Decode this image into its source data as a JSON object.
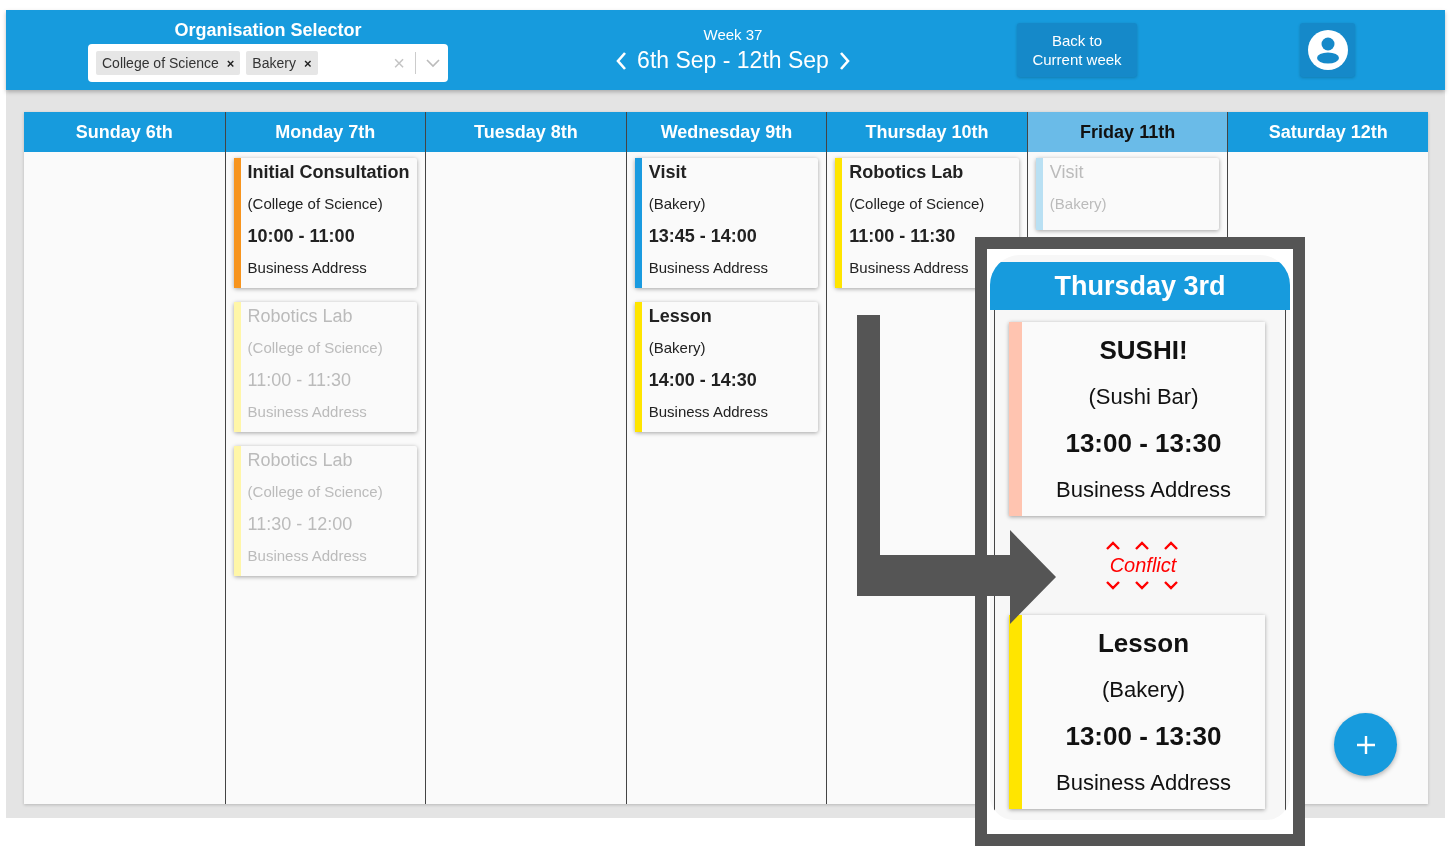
{
  "header": {
    "selector_label": "Organisation Selector",
    "selected_orgs": [
      {
        "label": "College of Science"
      },
      {
        "label": "Bakery"
      }
    ],
    "tag_remove": "×",
    "clear": "×",
    "week_label": "Week 37",
    "range": "6th Sep - 12th Sep",
    "back_button": "Back to Current week"
  },
  "days": [
    {
      "label": "Sunday 6th",
      "selected": false
    },
    {
      "label": "Monday 7th",
      "selected": false,
      "events": [
        {
          "title": "Initial Consultation",
          "org": "(College of Science)",
          "time": "10:00 - 11:00",
          "address": "Business Address",
          "color": "#f7941d",
          "faded": false
        },
        {
          "title": "Robotics Lab",
          "org": "(College of Science)",
          "time": "11:00 - 11:30",
          "address": "Business Address",
          "color": "#fff6a8",
          "faded": true
        },
        {
          "title": "Robotics Lab",
          "org": "(College of Science)",
          "time": "11:30 - 12:00",
          "address": "Business Address",
          "color": "#fff6a8",
          "faded": true
        }
      ]
    },
    {
      "label": "Tuesday 8th",
      "selected": false
    },
    {
      "label": "Wednesday 9th",
      "selected": false,
      "events": [
        {
          "title": "Visit",
          "org": "(Bakery)",
          "time": "13:45 - 14:00",
          "address": "Business Address",
          "color": "#1a9be0",
          "faded": false
        },
        {
          "title": "Lesson",
          "org": "(Bakery)",
          "time": "14:00 - 14:30",
          "address": "Business Address",
          "color": "#ffe500",
          "faded": false
        }
      ]
    },
    {
      "label": "Thursday 10th",
      "selected": false,
      "events": [
        {
          "title": "Robotics Lab",
          "org": "(College of Science)",
          "time": "11:00 - 11:30",
          "address": "Business Address",
          "color": "#ffe500",
          "faded": false
        }
      ]
    },
    {
      "label": "Friday 11th",
      "selected": true,
      "events": [
        {
          "title": "Visit",
          "org": "(Bakery)",
          "color": "#b9e0f3",
          "faded": true
        }
      ]
    },
    {
      "label": "Saturday 12th",
      "selected": false
    }
  ],
  "callout": {
    "day": "Thursday 3rd",
    "conflict_label": "Conflict",
    "events": [
      {
        "title": "SUSHI!",
        "org": "(Sushi Bar)",
        "time": "13:00 - 13:30",
        "address": "Business Address",
        "color": "#ffc4b0"
      },
      {
        "title": "Lesson",
        "org": "(Bakery)",
        "time": "13:00 - 13:30",
        "address": "Business Address",
        "color": "#ffe500"
      }
    ]
  }
}
